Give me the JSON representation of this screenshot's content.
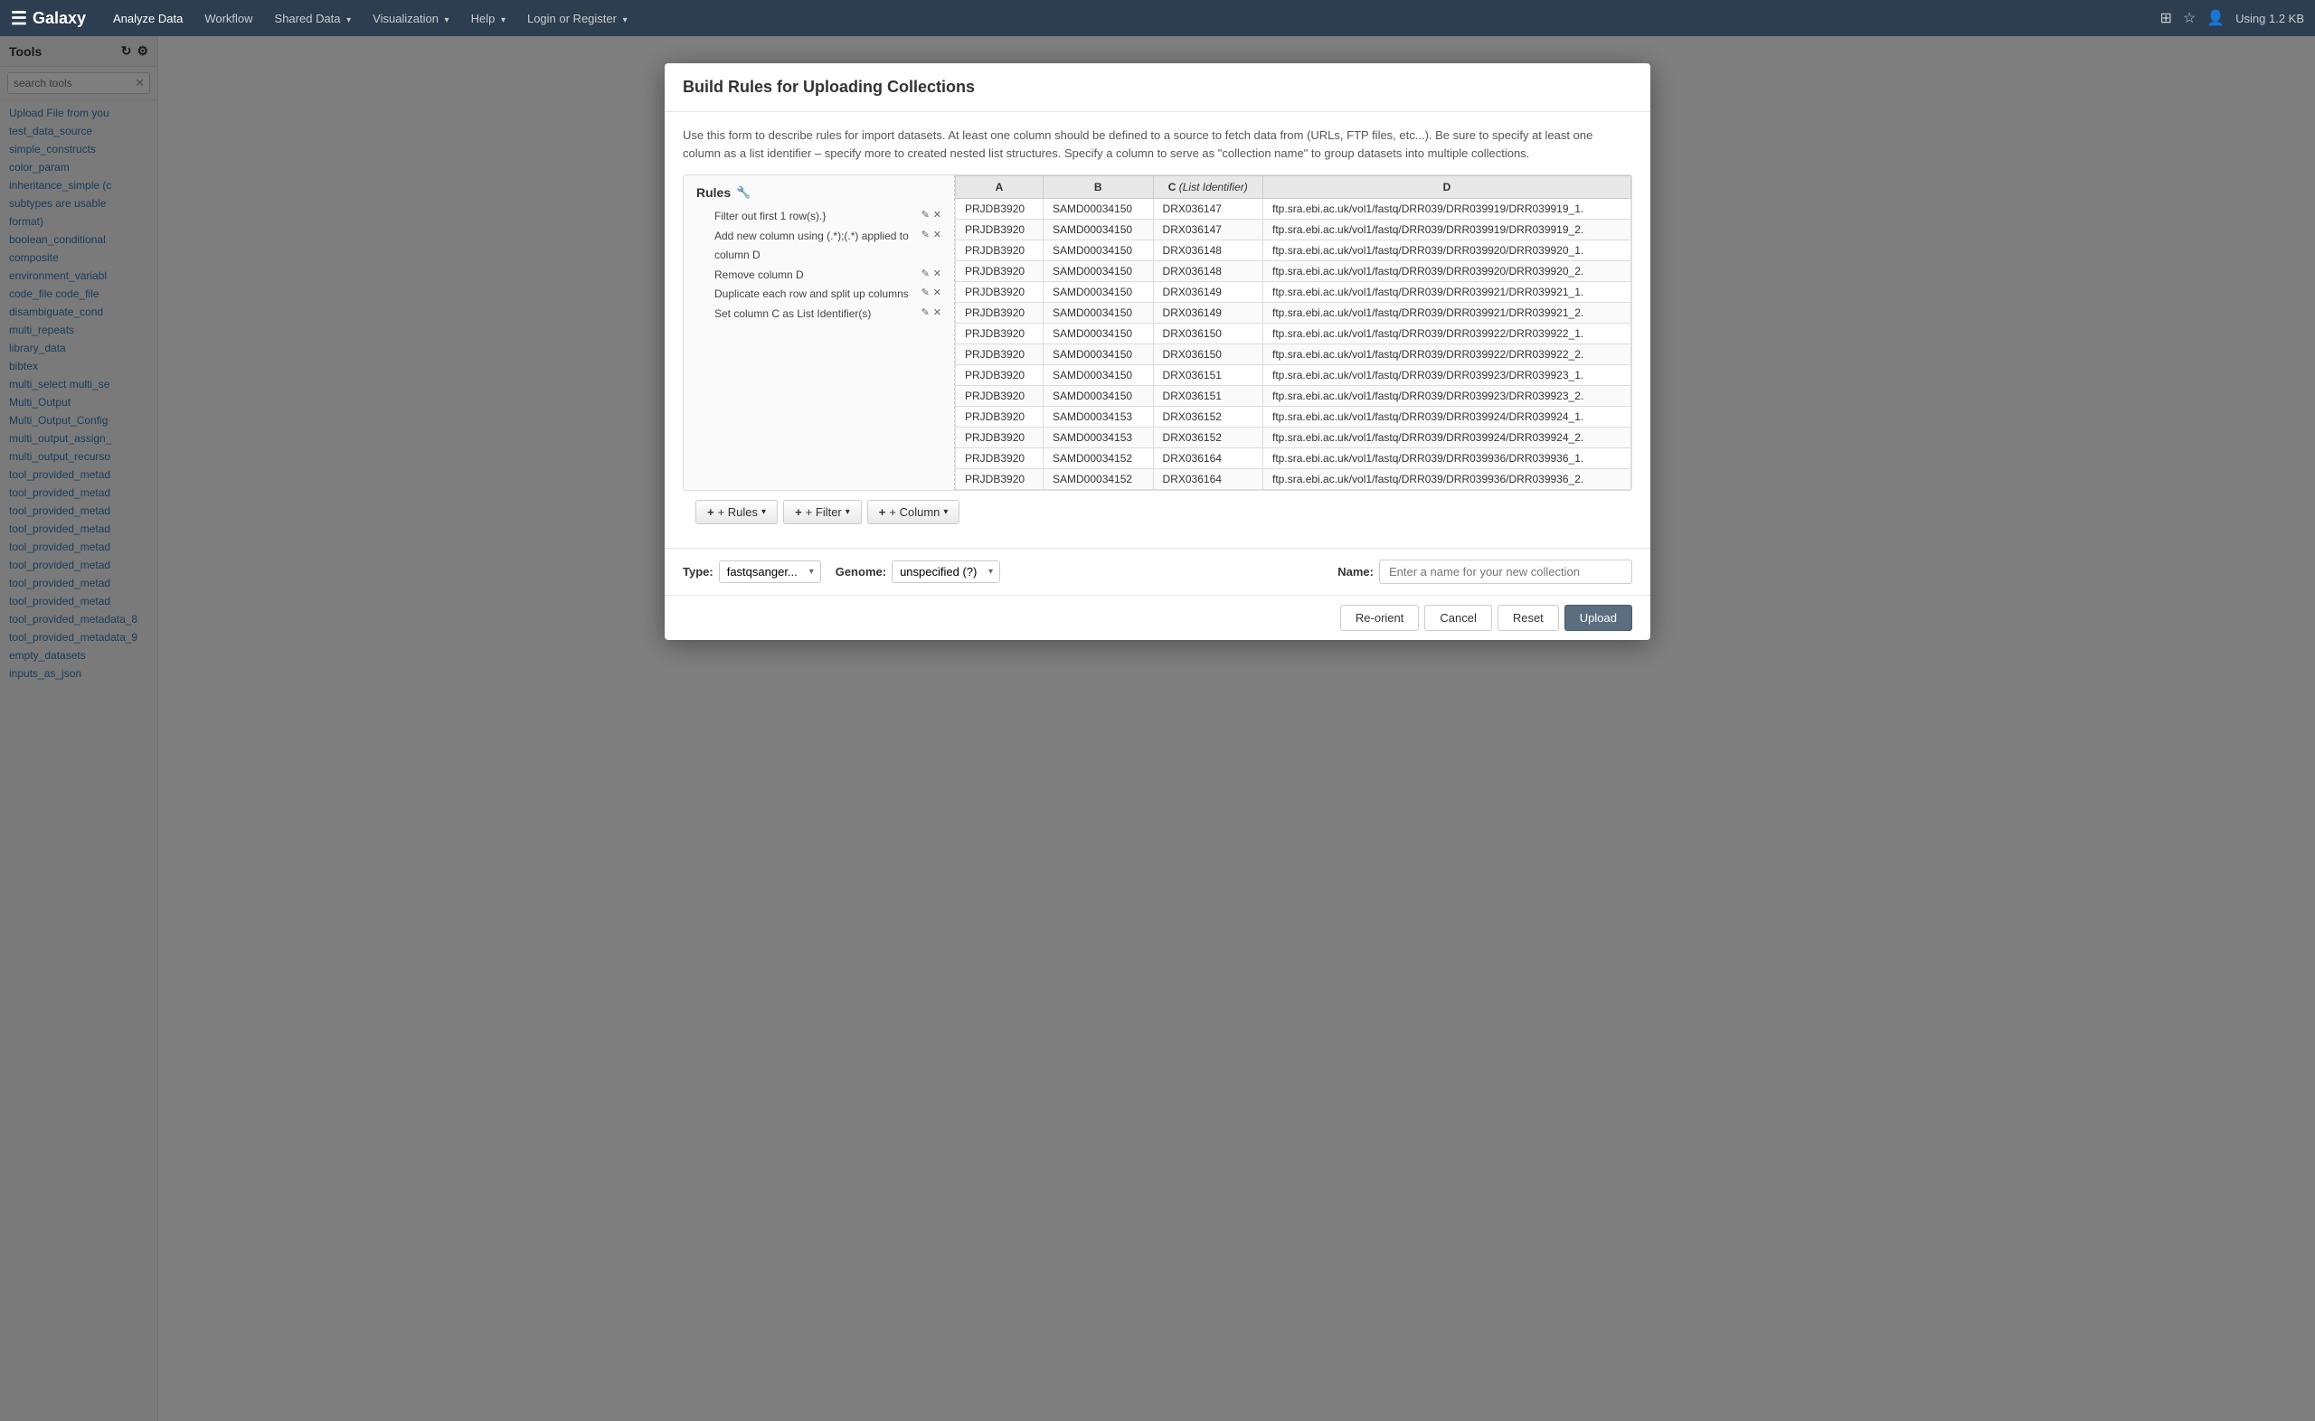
{
  "app": {
    "brand": "Galaxy",
    "using": "Using 1.2 KB"
  },
  "navbar": {
    "items": [
      {
        "label": "Analyze Data",
        "active": true
      },
      {
        "label": "Workflow",
        "active": false
      },
      {
        "label": "Shared Data",
        "dropdown": true
      },
      {
        "label": "Visualization",
        "dropdown": true
      },
      {
        "label": "Help",
        "dropdown": true
      },
      {
        "label": "Login or Register",
        "dropdown": true
      }
    ]
  },
  "sidebar": {
    "header": "Tools",
    "search_placeholder": "search tools",
    "tools": [
      "Upload File from you",
      "test_data_source",
      "simple_constructs",
      "color_param",
      "inheritance_simple (c",
      "subtypes are usable",
      "format)",
      "boolean_conditional",
      "composite",
      "environment_variabl",
      "code_file  code_file",
      "disambiguate_cond",
      "multi_repeats",
      "library_data",
      "bibtex",
      "multi_select  multi_se",
      "Multi_Output",
      "Multi_Output_Config",
      "multi_output_assign_",
      "multi_output_recurso",
      "tool_provided_metad",
      "tool_provided_metad",
      "tool_provided_metad",
      "tool_provided_metad",
      "tool_provided_metad",
      "tool_provided_metad",
      "tool_provided_metad",
      "tool_provided_metad",
      "tool_provided_metadata_8",
      "tool_provided_metadata_9",
      "empty_datasets",
      "inputs_as_json"
    ]
  },
  "modal": {
    "title": "Build Rules for Uploading Collections",
    "description": "Use this form to describe rules for import datasets. At least one column should be defined to a source to fetch data from (URLs, FTP files, etc...). Be sure to specify at least one column as a list identifier – specify more to created nested list structures. Specify a column to serve as \"collection name\" to group datasets into multiple collections.",
    "rules_title": "Rules",
    "rules": [
      {
        "text": "Filter out first 1 row(s).}",
        "edit": true,
        "delete": true
      },
      {
        "text": "Add new column using (.*);(.*) applied to column D",
        "edit": true,
        "delete": true
      },
      {
        "text": "Remove column D",
        "edit": true,
        "delete": true
      },
      {
        "text": "Duplicate each row and split up columns",
        "edit": true,
        "delete": true
      },
      {
        "text": "Set column C as List Identifier(s)",
        "edit": true,
        "delete": true
      }
    ],
    "table": {
      "columns": [
        "A",
        "B",
        "C (List Identifier)",
        "D"
      ],
      "rows": [
        [
          "PRJDB3920",
          "SAMD00034150",
          "DRX036147",
          "ftp.sra.ebi.ac.uk/vol1/fastq/DRR039/DRR039919/DRR039919_1."
        ],
        [
          "PRJDB3920",
          "SAMD00034150",
          "DRX036147",
          "ftp.sra.ebi.ac.uk/vol1/fastq/DRR039/DRR039919/DRR039919_2."
        ],
        [
          "PRJDB3920",
          "SAMD00034150",
          "DRX036148",
          "ftp.sra.ebi.ac.uk/vol1/fastq/DRR039/DRR039920/DRR039920_1."
        ],
        [
          "PRJDB3920",
          "SAMD00034150",
          "DRX036148",
          "ftp.sra.ebi.ac.uk/vol1/fastq/DRR039/DRR039920/DRR039920_2."
        ],
        [
          "PRJDB3920",
          "SAMD00034150",
          "DRX036149",
          "ftp.sra.ebi.ac.uk/vol1/fastq/DRR039/DRR039921/DRR039921_1."
        ],
        [
          "PRJDB3920",
          "SAMD00034150",
          "DRX036149",
          "ftp.sra.ebi.ac.uk/vol1/fastq/DRR039/DRR039921/DRR039921_2."
        ],
        [
          "PRJDB3920",
          "SAMD00034150",
          "DRX036150",
          "ftp.sra.ebi.ac.uk/vol1/fastq/DRR039/DRR039922/DRR039922_1."
        ],
        [
          "PRJDB3920",
          "SAMD00034150",
          "DRX036150",
          "ftp.sra.ebi.ac.uk/vol1/fastq/DRR039/DRR039922/DRR039922_2."
        ],
        [
          "PRJDB3920",
          "SAMD00034150",
          "DRX036151",
          "ftp.sra.ebi.ac.uk/vol1/fastq/DRR039/DRR039923/DRR039923_1."
        ],
        [
          "PRJDB3920",
          "SAMD00034150",
          "DRX036151",
          "ftp.sra.ebi.ac.uk/vol1/fastq/DRR039/DRR039923/DRR039923_2."
        ],
        [
          "PRJDB3920",
          "SAMD00034153",
          "DRX036152",
          "ftp.sra.ebi.ac.uk/vol1/fastq/DRR039/DRR039924/DRR039924_1."
        ],
        [
          "PRJDB3920",
          "SAMD00034153",
          "DRX036152",
          "ftp.sra.ebi.ac.uk/vol1/fastq/DRR039/DRR039924/DRR039924_2."
        ],
        [
          "PRJDB3920",
          "SAMD00034152",
          "DRX036164",
          "ftp.sra.ebi.ac.uk/vol1/fastq/DRR039/DRR039936/DRR039936_1."
        ],
        [
          "PRJDB3920",
          "SAMD00034152",
          "DRX036164",
          "ftp.sra.ebi.ac.uk/vol1/fastq/DRR039/DRR039936/DRR039936_2."
        ]
      ]
    },
    "buttons": {
      "rules": "+ Rules",
      "filter": "+ Filter",
      "column": "+ Column"
    },
    "footer": {
      "type_label": "Type:",
      "type_value": "fastqsanger...",
      "genome_label": "Genome:",
      "genome_value": "unspecified (?)",
      "name_label": "Name:",
      "name_placeholder": "Enter a name for your new collection"
    },
    "actions": {
      "reorient": "Re-orient",
      "cancel": "Cancel",
      "reset": "Reset",
      "upload": "Upload"
    }
  }
}
